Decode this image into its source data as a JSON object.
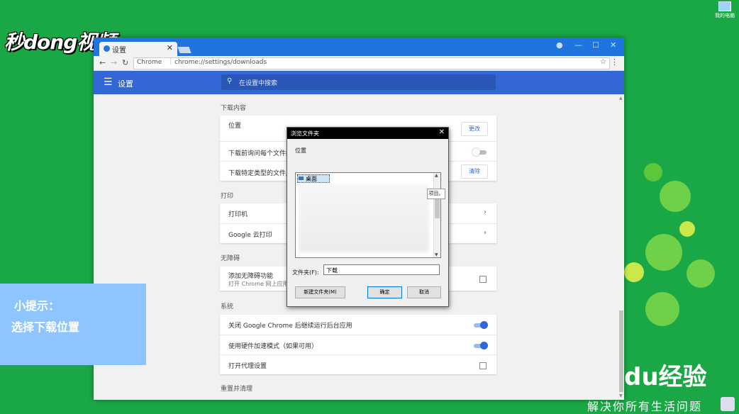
{
  "watermark": {
    "logo": "秒dong视频"
  },
  "desktop": {
    "my_computer_label": "我的电脑"
  },
  "baidu": {
    "logo": "du经验",
    "slogan": "解决你所有生活问题"
  },
  "tip": {
    "title": "小提示：",
    "text": "选择下载位置"
  },
  "browser": {
    "tab_title": "设置",
    "tab_close": "✕",
    "window_controls": [
      "—",
      "☐",
      "✕"
    ],
    "nav": {
      "back": "←",
      "forward": "→",
      "reload": "↻"
    },
    "omnibox": {
      "secure_label": "Chrome",
      "url": "chrome://settings/downloads",
      "star": "☆"
    },
    "menu": "⋮",
    "settings_title": "设置",
    "search_placeholder": "在设置中搜索"
  },
  "settings": {
    "downloads": {
      "heading": "下载内容",
      "location_label": "位置",
      "change_button": "更改",
      "ask_label": "下载前询问每个文件的保",
      "auto_open_label": "下载特定类型的文件后自",
      "clear_button": "清除"
    },
    "printing": {
      "heading": "打印",
      "printers": "打印机",
      "cloud_print": "Google 云打印"
    },
    "accessibility": {
      "heading": "无障碍",
      "add_label": "添加无障碍功能",
      "add_sub": "打开 Chrome 网上应用店"
    },
    "system": {
      "heading": "系统",
      "background_apps": "关闭 Google Chrome 后继续运行后台应用",
      "hardware_accel": "使用硬件加速模式（如果可用）",
      "proxy": "打开代理设置"
    },
    "reset": {
      "heading": "重置并清理"
    }
  },
  "dialog": {
    "title": "浏览文件夹",
    "close": "✕",
    "location_label": "位置",
    "tree_root": "桌面",
    "tooltip": "项目。",
    "folder_label": "文件夹(F):",
    "folder_value": "下载",
    "new_folder_button": "新建文件夹(M)",
    "ok_button": "确定",
    "cancel_button": "取消"
  },
  "colors": {
    "desktop_bg": "#1aa745",
    "chrome_blue": "#3367d6",
    "tip_bg": "#8fc5ff"
  }
}
